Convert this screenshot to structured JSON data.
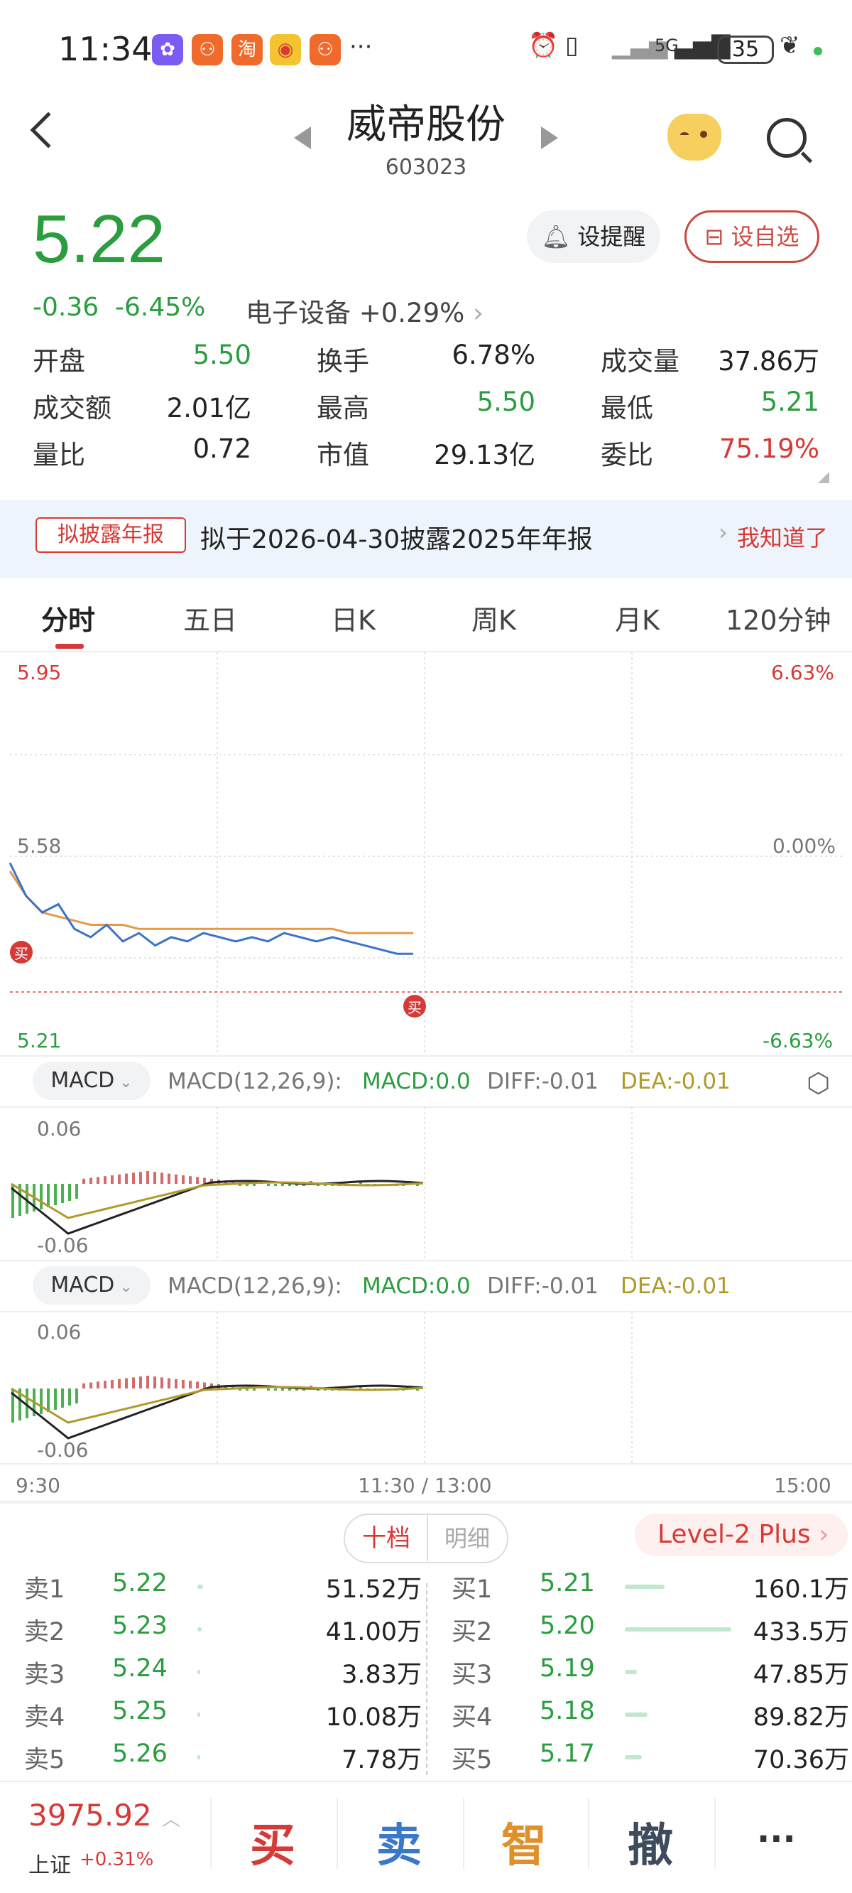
{
  "status_bar": {
    "time": "11:34",
    "battery": "35",
    "network": "5G"
  },
  "header": {
    "stock_name": "威帝股份",
    "stock_code": "603023"
  },
  "quote": {
    "price": "5.22",
    "change": "-0.36",
    "change_pct": "-6.45%",
    "sector_label": "电子设备 +0.29%",
    "remind_label": "设提醒",
    "add_label": "设自选"
  },
  "stats": [
    {
      "label": "开盘",
      "value": "5.50",
      "color": "#2a9d3f"
    },
    {
      "label": "换手",
      "value": "6.78%",
      "color": "#222222"
    },
    {
      "label": "成交量",
      "value": "37.86万",
      "color": "#222222"
    },
    {
      "label": "成交额",
      "value": "2.01亿",
      "color": "#222222"
    },
    {
      "label": "最高",
      "value": "5.50",
      "color": "#2a9d3f"
    },
    {
      "label": "最低",
      "value": "5.21",
      "color": "#2a9d3f"
    },
    {
      "label": "量比",
      "value": "0.72",
      "color": "#222222"
    },
    {
      "label": "市值",
      "value": "29.13亿",
      "color": "#222222"
    },
    {
      "label": "委比",
      "value": "75.19%",
      "color": "#d63a36"
    }
  ],
  "notice": {
    "tag": "拟披露年报",
    "text": "拟于2026-04-30披露2025年年报",
    "action": "我知道了"
  },
  "tabs": [
    "分时",
    "五日",
    "日K",
    "周K",
    "月K",
    "120分钟"
  ],
  "chart_labels": {
    "price_high": "5.95",
    "price_mid": "5.58",
    "price_low": "5.21",
    "pct_high": "6.63%",
    "pct_mid": "0.00%",
    "pct_low": "-6.63%",
    "buy_marker": "买",
    "macd_pill": "MACD",
    "macd_param": "MACD(12,26,9):",
    "macd_val": "MACD:0.0",
    "diff_val": "DIFF:-0.01",
    "dea_val": "DEA:-0.01",
    "macd_top": "0.06",
    "macd_bot": "-0.06",
    "time_start": "9:30",
    "time_mid": "11:30 / 13:00",
    "time_end": "15:00"
  },
  "chart_data": {
    "type": "line",
    "title": "",
    "x_range": [
      "9:30",
      "15:00"
    ],
    "ylim": [
      5.21,
      5.95
    ],
    "baseline": 5.58,
    "series": [
      {
        "values": [
          5.44,
          5.36,
          5.32,
          5.34,
          5.28,
          5.26,
          5.29,
          5.25,
          5.27,
          5.24,
          5.26,
          5.25,
          5.27,
          5.26,
          5.25,
          5.26,
          5.25,
          5.27,
          5.26,
          5.25,
          5.26,
          5.25,
          5.24,
          5.23,
          5.22,
          5.22
        ]
      },
      {
        "values": [
          5.42,
          5.36,
          5.32,
          5.31,
          5.3,
          5.29,
          5.29,
          5.29,
          5.28,
          5.28,
          5.28,
          5.28,
          5.28,
          5.28,
          5.28,
          5.28,
          5.28,
          5.28,
          5.28,
          5.28,
          5.28,
          5.27,
          5.27,
          5.27,
          5.27,
          5.27
        ]
      }
    ]
  },
  "orderbook": {
    "tab_active": "十档",
    "tab_inactive": "明细",
    "level2": "Level-2 Plus",
    "asks": [
      {
        "label": "卖1",
        "price": "5.22",
        "vol": "51.52万",
        "bar": 0.05
      },
      {
        "label": "卖2",
        "price": "5.23",
        "vol": "41.00万",
        "bar": 0.04
      },
      {
        "label": "卖3",
        "price": "5.24",
        "vol": "3.83万",
        "bar": 0.01
      },
      {
        "label": "卖4",
        "price": "5.25",
        "vol": "10.08万",
        "bar": 0.01
      },
      {
        "label": "卖5",
        "price": "5.26",
        "vol": "7.78万",
        "bar": 0.01
      }
    ],
    "bids": [
      {
        "label": "买1",
        "price": "5.21",
        "vol": "160.1万",
        "bar": 0.37
      },
      {
        "label": "买2",
        "price": "5.20",
        "vol": "433.5万",
        "bar": 1.0
      },
      {
        "label": "买3",
        "price": "5.19",
        "vol": "47.85万",
        "bar": 0.11
      },
      {
        "label": "买4",
        "price": "5.18",
        "vol": "89.82万",
        "bar": 0.21
      },
      {
        "label": "买5",
        "price": "5.17",
        "vol": "70.36万",
        "bar": 0.16
      }
    ]
  },
  "bottom": {
    "index_value": "3975.92",
    "index_name": "上证",
    "index_change": "+0.31%",
    "buy": "买",
    "sell": "卖",
    "smart": "智",
    "cancel": "撤",
    "more": "···"
  }
}
